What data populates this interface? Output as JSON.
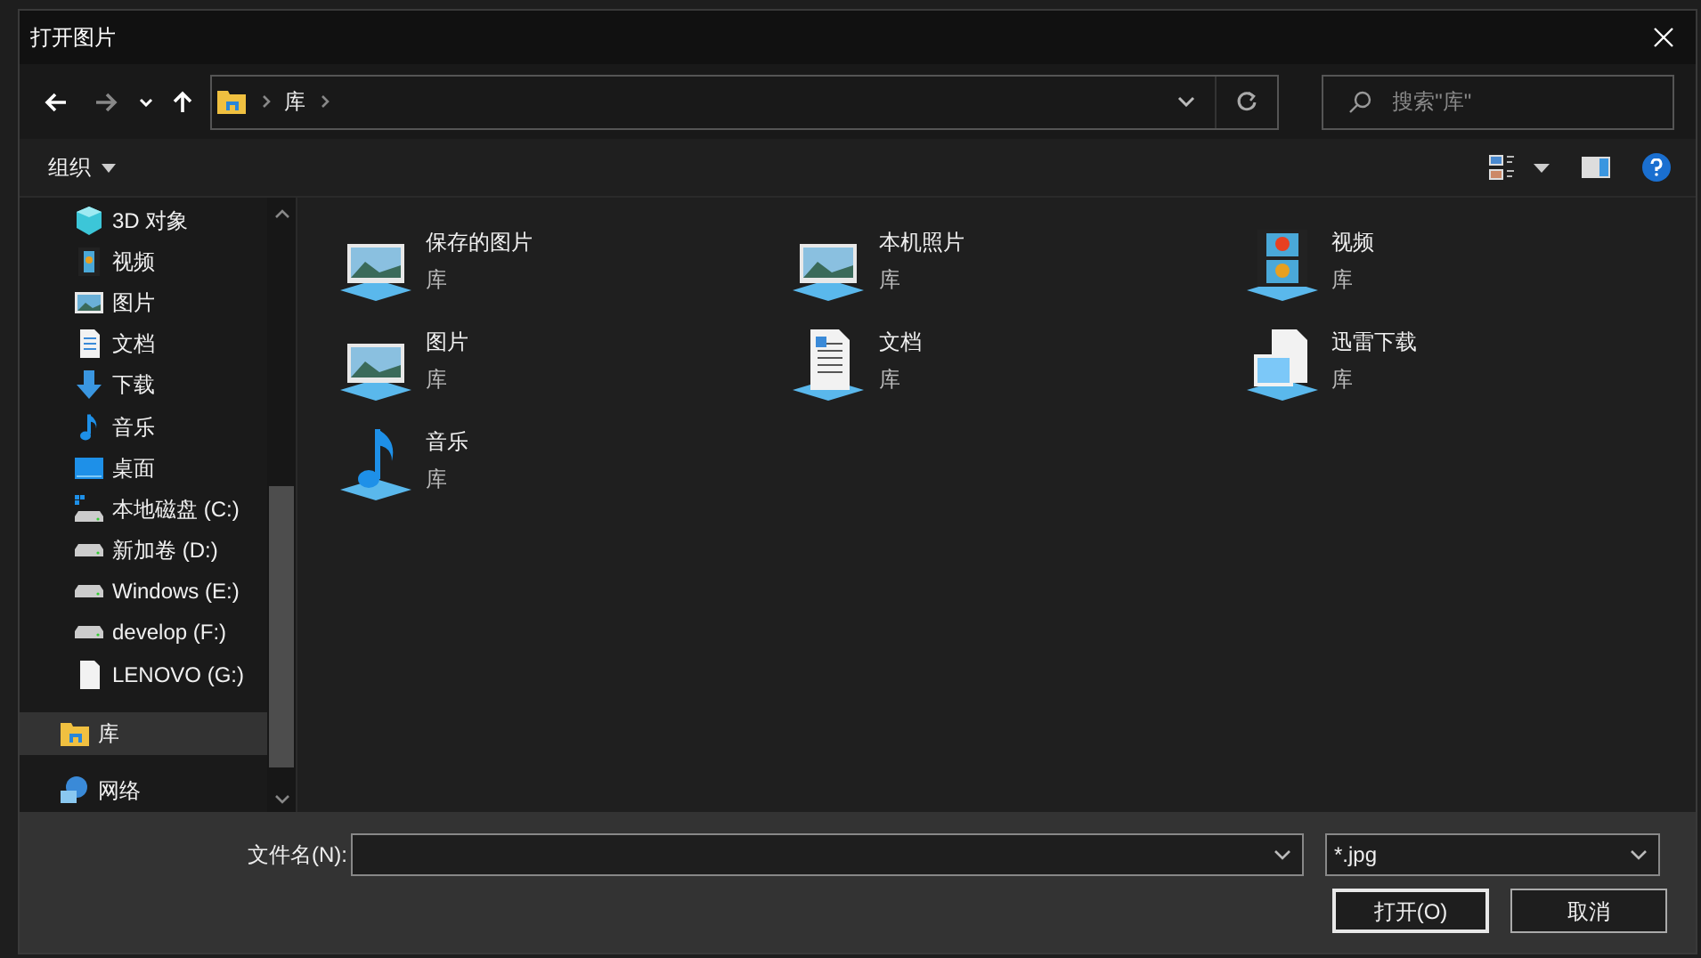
{
  "window": {
    "title": "打开图片"
  },
  "address_bar": {
    "path": [
      {
        "label": "库"
      }
    ]
  },
  "search": {
    "placeholder": "搜索\"库\""
  },
  "toolbar": {
    "organize": "组织"
  },
  "sidebar": {
    "this_pc_children": [
      {
        "label": "3D 对象",
        "kind": "cube",
        "selected": false
      },
      {
        "label": "视频",
        "kind": "video",
        "selected": false
      },
      {
        "label": "图片",
        "kind": "picture",
        "selected": false
      },
      {
        "label": "文档",
        "kind": "document",
        "selected": false
      },
      {
        "label": "下载",
        "kind": "download",
        "selected": false
      },
      {
        "label": "音乐",
        "kind": "music",
        "selected": false
      },
      {
        "label": "桌面",
        "kind": "desktop",
        "selected": false
      },
      {
        "label": "本地磁盘 (C:)",
        "kind": "system-drive",
        "selected": false
      },
      {
        "label": "新加卷 (D:)",
        "kind": "drive",
        "selected": false
      },
      {
        "label": "Windows (E:)",
        "kind": "drive",
        "selected": false
      },
      {
        "label": "develop (F:)",
        "kind": "drive",
        "selected": false
      },
      {
        "label": "LENOVO (G:)",
        "kind": "file",
        "selected": false
      }
    ],
    "items": [
      {
        "label": "库",
        "kind": "library",
        "selected": true
      },
      {
        "label": "网络",
        "kind": "network",
        "selected": false
      }
    ]
  },
  "libraries": [
    {
      "name": "保存的图片",
      "type": "库",
      "kind": "picture"
    },
    {
      "name": "本机照片",
      "type": "库",
      "kind": "picture"
    },
    {
      "name": "视频",
      "type": "库",
      "kind": "video"
    },
    {
      "name": "图片",
      "type": "库",
      "kind": "picture"
    },
    {
      "name": "文档",
      "type": "库",
      "kind": "document"
    },
    {
      "name": "迅雷下载",
      "type": "库",
      "kind": "blank"
    },
    {
      "name": "音乐",
      "type": "库",
      "kind": "music"
    }
  ],
  "file_name": {
    "label": "文件名(N):"
  },
  "file_type": {
    "value": "*.jpg"
  },
  "buttons": [
    {
      "label": "打开(O)",
      "kind": "primary"
    },
    {
      "label": "取消",
      "kind": "normal"
    }
  ]
}
